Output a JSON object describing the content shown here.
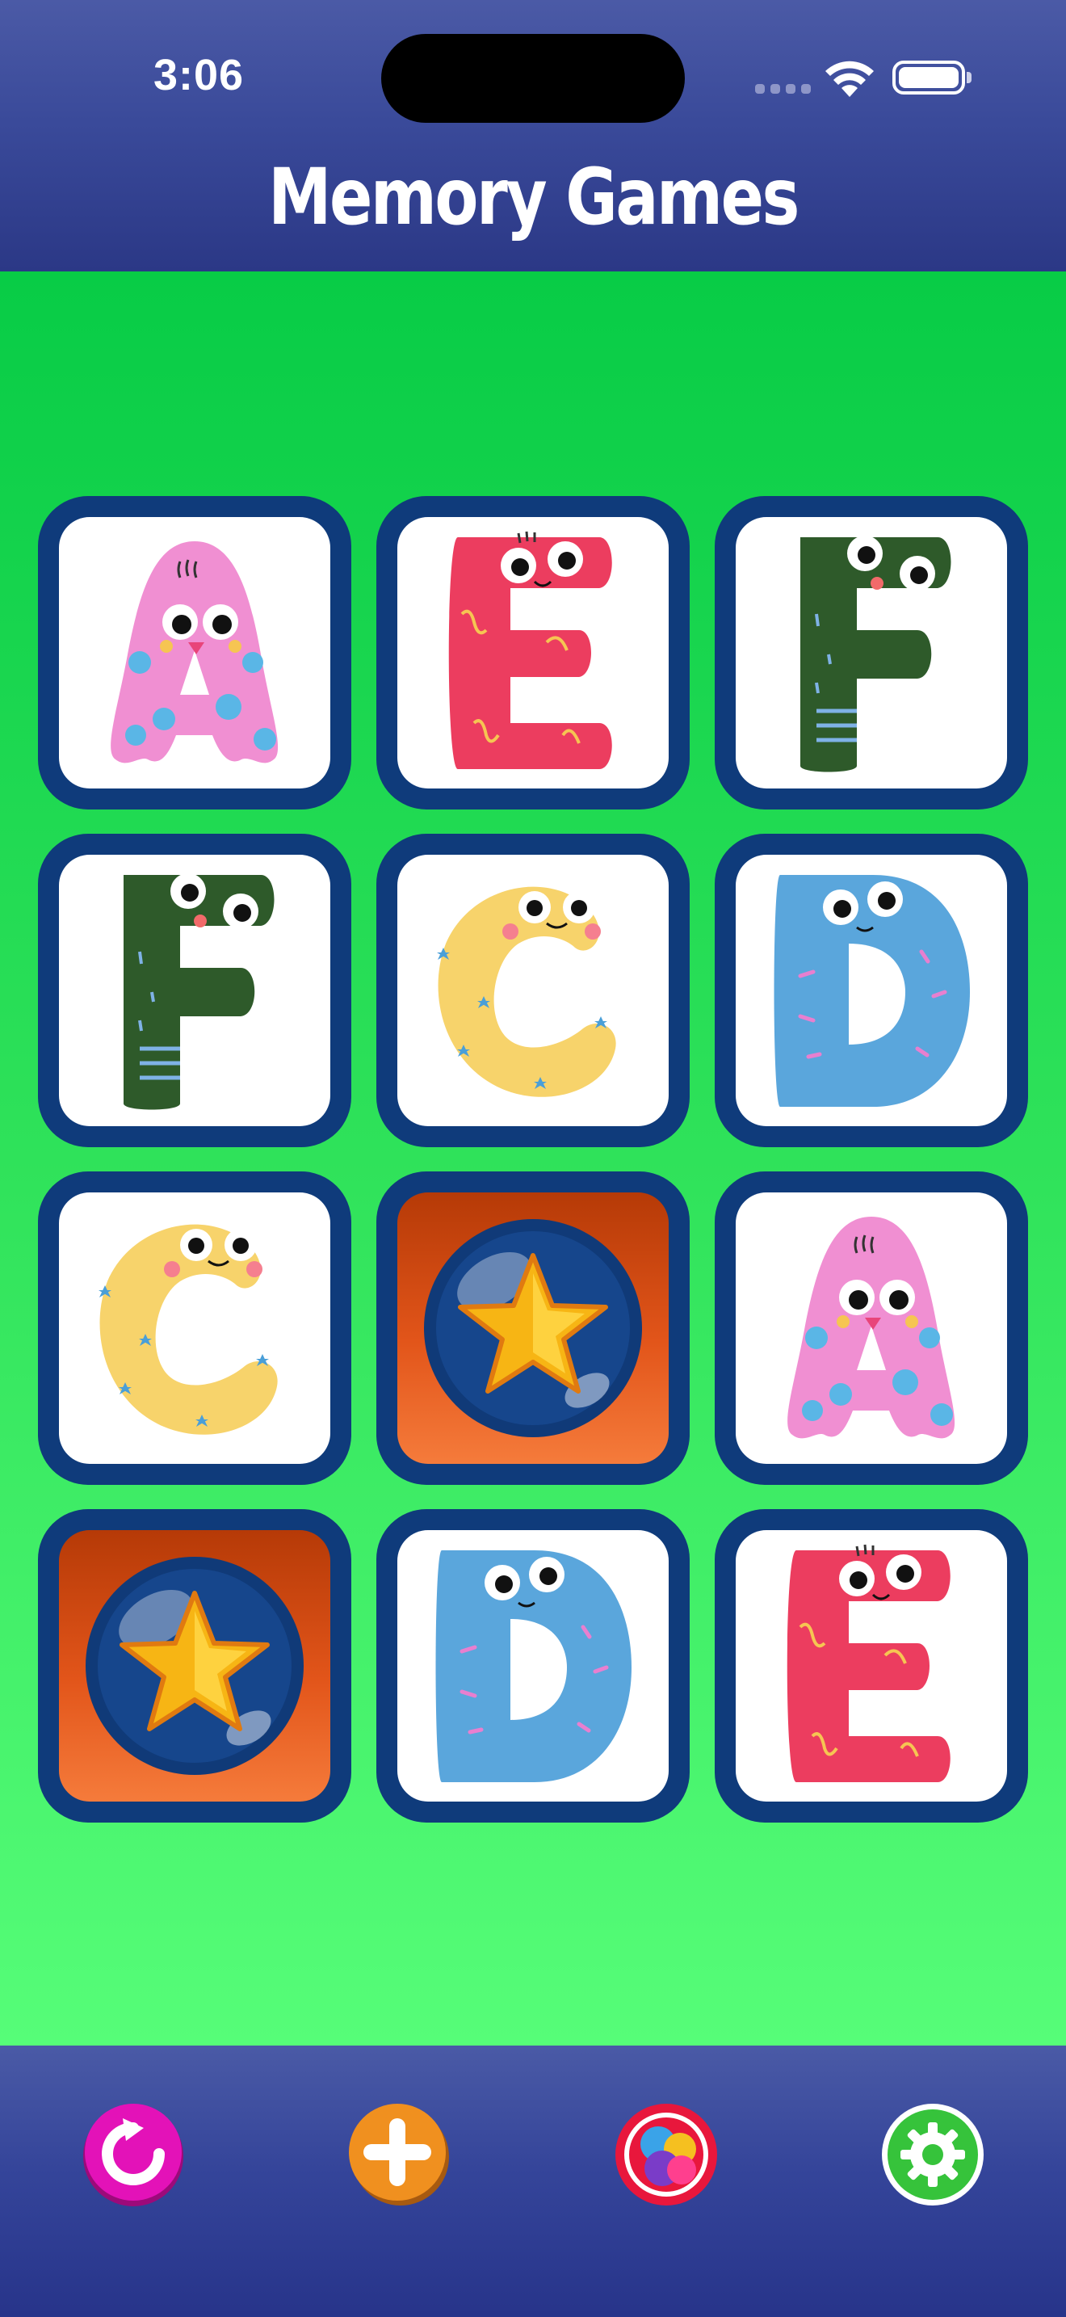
{
  "status_bar": {
    "time": "3:06"
  },
  "header": {
    "title": "Memory Games"
  },
  "board": {
    "cards": [
      {
        "letter": "A",
        "state": "face-up"
      },
      {
        "letter": "E",
        "state": "face-up"
      },
      {
        "letter": "F",
        "state": "face-up"
      },
      {
        "letter": "F",
        "state": "face-up"
      },
      {
        "letter": "C",
        "state": "face-up"
      },
      {
        "letter": "D",
        "state": "face-up"
      },
      {
        "letter": "C",
        "state": "face-up"
      },
      {
        "letter": "",
        "state": "face-down"
      },
      {
        "letter": "A",
        "state": "face-up"
      },
      {
        "letter": "",
        "state": "face-down"
      },
      {
        "letter": "D",
        "state": "face-up"
      },
      {
        "letter": "E",
        "state": "face-up"
      }
    ]
  },
  "toolbar": {
    "buttons": [
      {
        "name": "restart-button",
        "icon": "restart-icon",
        "color": "#e312b8"
      },
      {
        "name": "add-button",
        "icon": "plus-icon",
        "color": "#f0901f"
      },
      {
        "name": "more-games-button",
        "icon": "colorful-balls-icon",
        "color": "#e8173c"
      },
      {
        "name": "settings-button",
        "icon": "gear-icon",
        "color": "#36c33b"
      }
    ]
  },
  "colors": {
    "header_blue": "#3a4a9a",
    "board_green": "#2fe25a",
    "card_border": "#0f3b7b",
    "card_back_orange": "#e2551a"
  }
}
